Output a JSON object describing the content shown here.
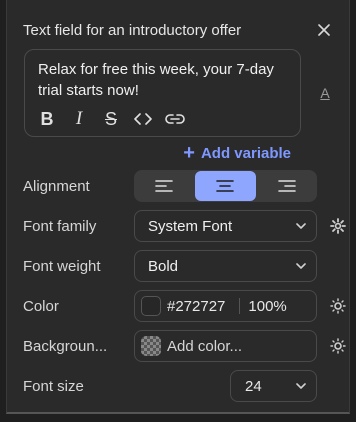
{
  "panel": {
    "title": "Text field for an introductory offer",
    "close_icon": "close-icon"
  },
  "editor": {
    "content": "Relax for free this week, your 7-day trial starts now!",
    "tools": [
      "B",
      "I",
      "S",
      "<>",
      "link-icon"
    ],
    "side_button": "A"
  },
  "add_variable": {
    "plus": "+",
    "label": "Add variable",
    "color": "#7f98ff"
  },
  "alignment": {
    "label": "Alignment",
    "options": [
      "align-left-icon",
      "align-center-icon",
      "align-right-icon"
    ],
    "selected": "center"
  },
  "font_family": {
    "label": "Font family",
    "value": "System Font",
    "side_icon": "gear-icon"
  },
  "font_weight": {
    "label": "Font weight",
    "value": "Bold"
  },
  "color": {
    "label": "Color",
    "hex": "#272727",
    "opacity": "100%",
    "side_icon": "sun-icon"
  },
  "background": {
    "label": "Backgroun...",
    "placeholder": "Add color...",
    "side_icon": "sun-icon"
  },
  "font_size": {
    "label": "Font size",
    "value": "24"
  }
}
